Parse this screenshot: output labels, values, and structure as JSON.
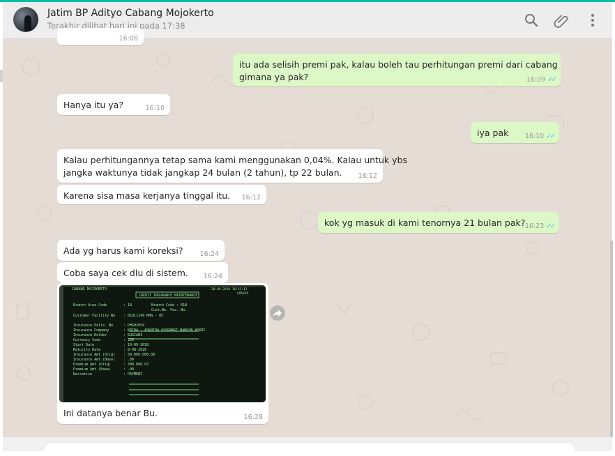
{
  "header": {
    "contact_name": "Jatim BP Adityo Cabang Mojokerto",
    "last_seen": "Terakhir dilihat hari ini pada 17:38",
    "icons": [
      "search-icon",
      "attach-icon",
      "menu-icon"
    ]
  },
  "colors": {
    "header_bg": "#ededed",
    "chat_bg": "#e5ddd5",
    "incoming_bg": "#ffffff",
    "outgoing_bg": "#dcf8c6",
    "read_ticks": "#4fc3f7",
    "accent": "#00bfa5"
  },
  "messages": [
    {
      "dir": "in",
      "text": "",
      "time": "16:06"
    },
    {
      "dir": "out",
      "text": "itu ada selisih premi pak, kalau boleh tau perhitungan premi dari cabang\ngimana ya pak?",
      "time": "16:09"
    },
    {
      "dir": "in",
      "text": "Hanya itu ya?",
      "time": "16:10"
    },
    {
      "dir": "out",
      "text": "iya pak",
      "time": "16:10"
    },
    {
      "dir": "in",
      "text": "Kalau perhitungannya tetap sama kami menggunakan 0,04%. Kalau untuk ybs\njangka waktunya tidak jangkap 24 bulan (2 tahun), tp 22 bulan.",
      "time": "16:12"
    },
    {
      "dir": "in",
      "text": "Karena sisa masa kerjanya tinggal itu.",
      "time": "16:12"
    },
    {
      "dir": "out",
      "text": "kok yg masuk di kami tenornya 21 bulan pak?",
      "time": "16:23"
    },
    {
      "dir": "in",
      "text": "Ada yg harus kami koreksi?",
      "time": "16:24"
    },
    {
      "dir": "in",
      "text": "Coba saya cek dlu di sistem.",
      "time": "16:24"
    },
    {
      "dir": "in",
      "text": "Ini datanya benar Bu.",
      "time": "16:28",
      "has_image": true
    }
  ],
  "image": {
    "header_left": "CABANG MOJOKERTO",
    "screen_title": "CREDIT INSURANCE MAINTENANCE",
    "rows": [
      {
        "label": "Branch Area Code",
        "value": ": 18",
        "extra": "Branch Code : 018"
      },
      {
        "label": "",
        "value": "",
        "extra": "Cust.No.  Fac. No."
      },
      {
        "label": "Customer Facility No",
        "value": ": 01811149  KMG - 05",
        "extra": ""
      },
      {
        "label": "Insurance Polis. No.",
        "value": ": PHS02054",
        "extra": ""
      },
      {
        "label": "Insurance Company",
        "value": ": KRIDA - ASKRIDA ASURANSI BANGUN ASKRI",
        "extra": ""
      },
      {
        "label": "Insurance Holder",
        "value": ": SUGIANI",
        "extra": ""
      },
      {
        "label": "Currency Code",
        "value": ": IDR",
        "extra": ""
      },
      {
        "label": "Start Date",
        "value": ": 10-09-2018",
        "extra": ""
      },
      {
        "label": "Maturity Date",
        "value": ": 8-08-2020",
        "extra": ""
      },
      {
        "label": "Insurance Amt (Orig)",
        "value": ": 50.000.000.00",
        "extra": ""
      },
      {
        "label": "Insurance Amt (Base)",
        "value": ": .00",
        "extra": ""
      },
      {
        "label": "Premium Amt (Orig)",
        "value": ": 308.000.07",
        "extra": ""
      },
      {
        "label": "Premium Amt (Base)",
        "value": ": .00",
        "extra": ""
      },
      {
        "label": "Narrative",
        "value": ": PAYMENT",
        "extra": ""
      }
    ]
  }
}
